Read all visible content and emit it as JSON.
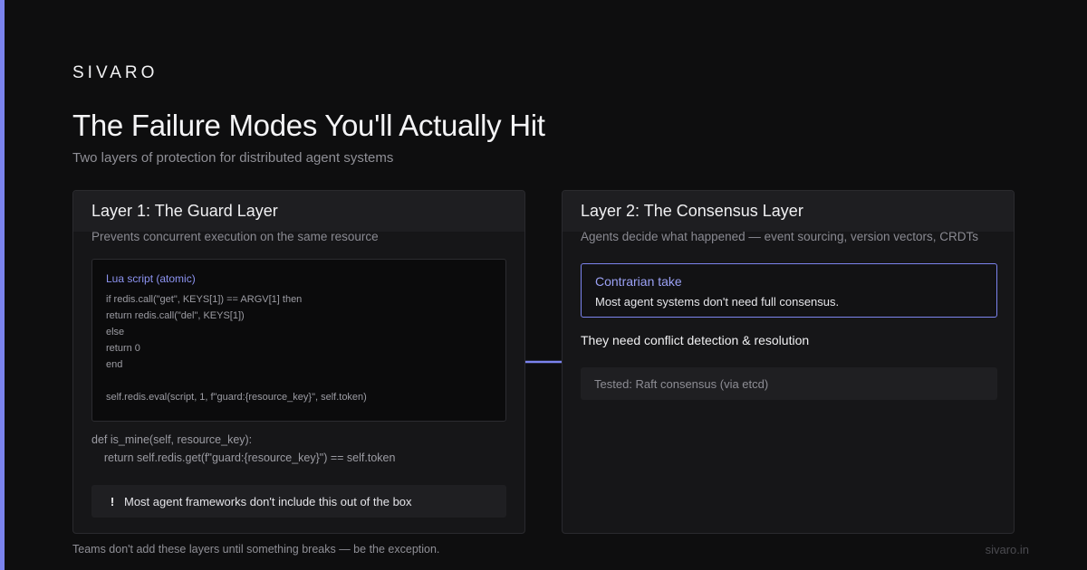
{
  "brand": "SIVARO",
  "title": "The Failure Modes You'll Actually Hit",
  "subtitle": "Two layers of protection for distributed agent systems",
  "colors": {
    "accent": "#7b83ee",
    "background": "#0e0e0f",
    "card": "#161618"
  },
  "layer1": {
    "title": "Layer 1: The Guard Layer",
    "description": "Prevents concurrent execution on the same resource",
    "code_label": "Lua script (atomic)",
    "code_lines": [
      "if redis.call(\"get\", KEYS[1]) == ARGV[1] then",
      "return redis.call(\"del\", KEYS[1])",
      "else",
      "return 0",
      "end",
      "",
      "self.redis.eval(script, 1, f\"guard:{resource_key}\", self.token)"
    ],
    "def_line1": "def is_mine(self, resource_key):",
    "def_line2": "    return self.redis.get(f\"guard:{resource_key}\") == self.token",
    "warning_icon": "!",
    "warning_text": "Most agent frameworks don't include this out of the box"
  },
  "layer2": {
    "title": "Layer 2: The Consensus Layer",
    "description": "Agents decide what happened — event sourcing, version vectors, CRDTs",
    "take_title": "Contrarian take",
    "take_text": "Most agent systems don't need full consensus.",
    "need_text": "They need conflict detection & resolution",
    "tested_text": "Tested: Raft consensus (via etcd)"
  },
  "footer": "Teams don't add these layers until something breaks — be the exception.",
  "domain": "sivaro.in"
}
